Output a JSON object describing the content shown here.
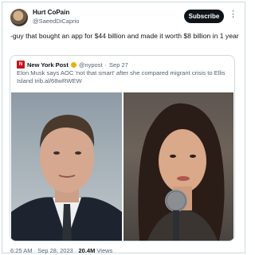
{
  "author": {
    "name": "Hurt CoPain",
    "handle": "@SaeedDiCaprio"
  },
  "subscribe_label": "Subscribe",
  "more_icon": "⋮",
  "tweet": {
    "text": "-guy that bought an app for $44 billion and made it worth $8 billion in 1 year"
  },
  "quoted": {
    "logo_icon": "N",
    "name": "New York Post",
    "handle": "@nypost",
    "separator": "·",
    "date": "Sep 27",
    "text": "Elon Musk says AOC 'not that smart' after she compared migrant crisis to Ellis Island trib.al/68wRWEW"
  },
  "footer": {
    "time": "6:25 AM · Sep 28, 2023 · ",
    "views_count": "20.4M",
    "views_label": " Views"
  }
}
